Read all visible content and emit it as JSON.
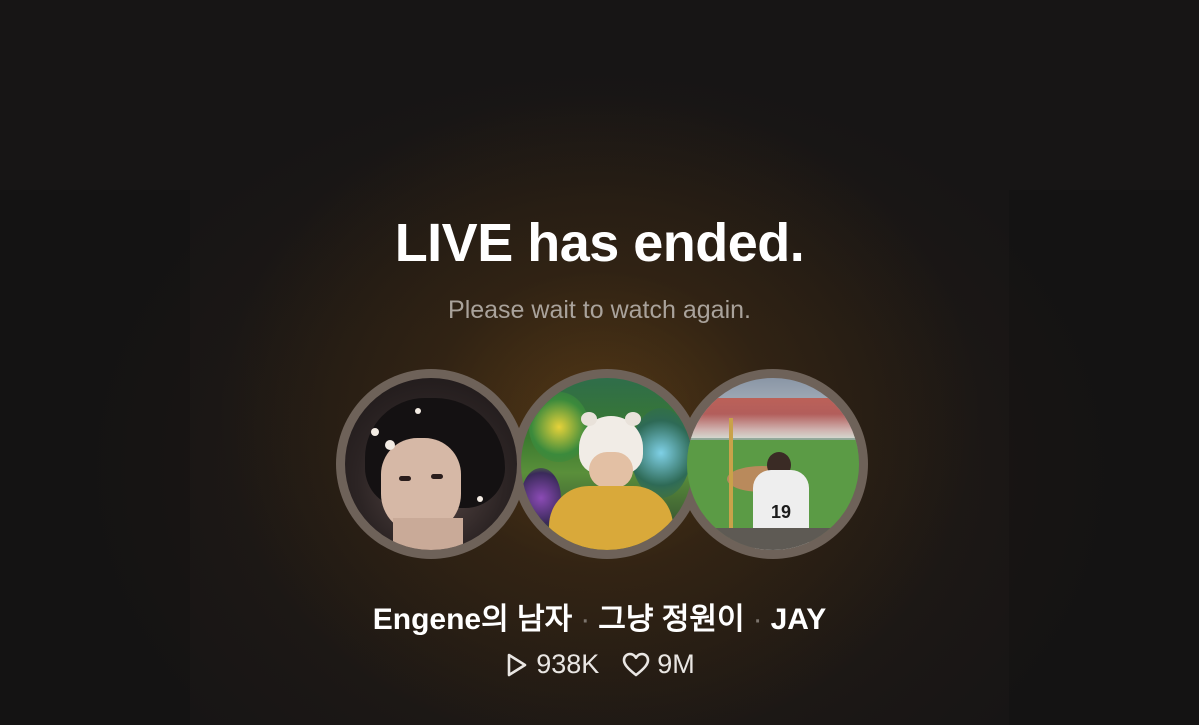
{
  "live": {
    "title": "LIVE has ended.",
    "subtitle": "Please wait to watch again."
  },
  "hosts": [
    {
      "name": "Engene의 남자"
    },
    {
      "name": "그냥 정원이"
    },
    {
      "name": "JAY"
    }
  ],
  "separator": "·",
  "stats": {
    "views": "938K",
    "likes": "9M"
  },
  "avatar3": {
    "jersey_number": "19"
  },
  "icons": {
    "views": "play-icon",
    "likes": "heart-icon"
  },
  "colors": {
    "background": "#171515",
    "glow": "#784e16",
    "title": "#ffffff",
    "subtitle": "#a9a29b",
    "avatar_ring": "#6e6259"
  }
}
